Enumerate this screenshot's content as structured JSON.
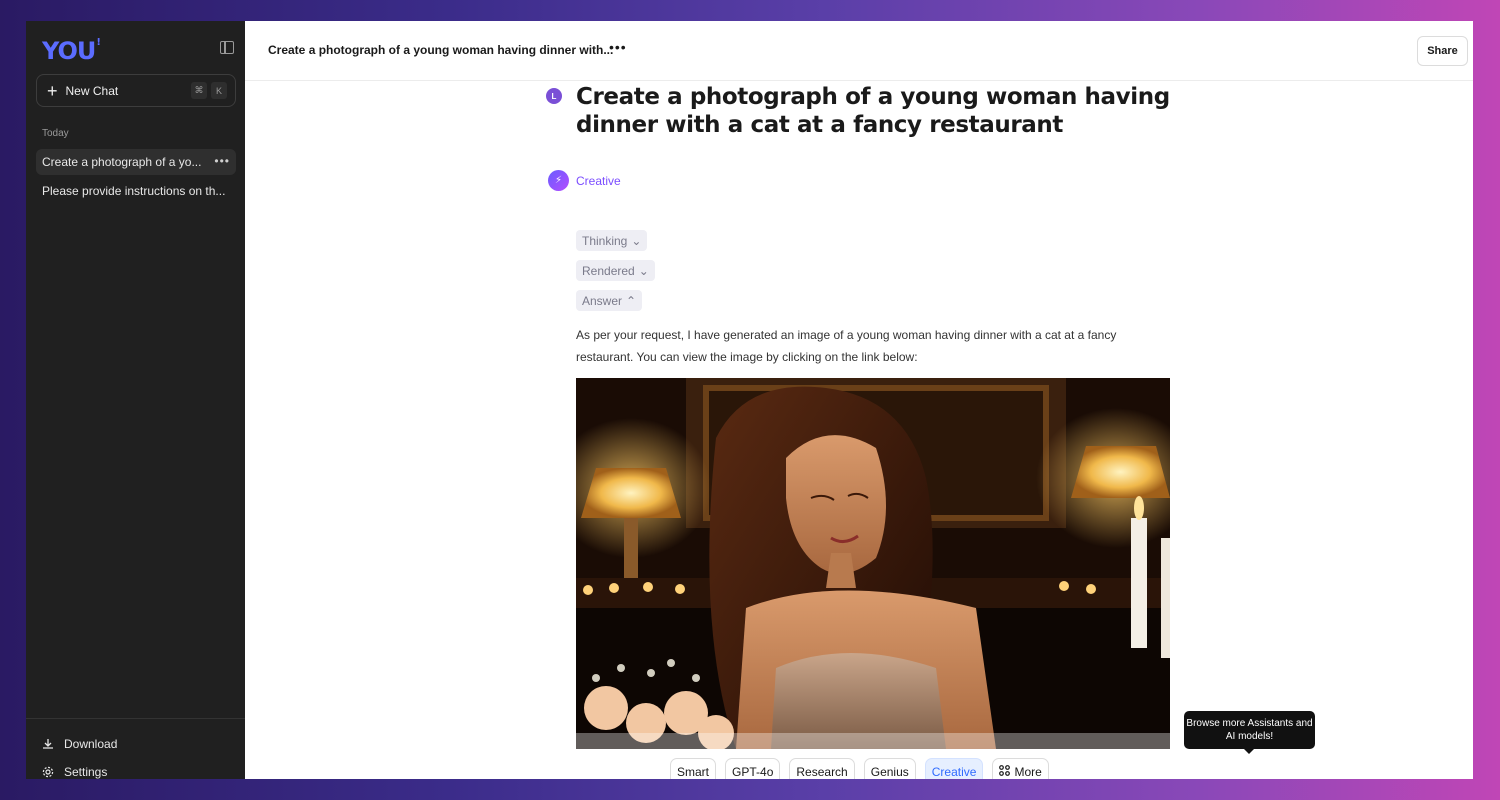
{
  "sidebar": {
    "logo": "YOU",
    "new_chat_label": "New Chat",
    "shortcut_keys": [
      "⌘",
      "K"
    ],
    "section_label": "Today",
    "history": [
      {
        "label": "Create a photograph of a yo...",
        "active": true
      },
      {
        "label": "Please provide instructions on th...",
        "active": false
      }
    ],
    "footer": {
      "download_label": "Download",
      "settings_label": "Settings"
    }
  },
  "header": {
    "title": "Create a photograph of a young woman having dinner with...",
    "more_icon": "ellipsis-icon",
    "share_label": "Share"
  },
  "conversation": {
    "user_initial": "L",
    "question": "Create a photograph of a young woman having dinner with a cat at a fancy restaurant",
    "mode_label": "Creative",
    "steps": [
      {
        "label": "Thinking",
        "chevron": "⌄"
      },
      {
        "label": "Rendered",
        "chevron": "⌄"
      },
      {
        "label": "Answer",
        "chevron": "⌃"
      }
    ],
    "answer_text": "As per your request, I have generated an image of a young woman having dinner with a cat at a fancy restaurant. You can view the image by clicking on the link below:"
  },
  "tooltip": {
    "text": "Browse more Assistants and AI models!"
  },
  "models": [
    {
      "label": "Smart",
      "active": false
    },
    {
      "label": "GPT-4o",
      "active": false
    },
    {
      "label": "Research",
      "active": false
    },
    {
      "label": "Genius",
      "active": false
    },
    {
      "label": "Creative",
      "active": true
    },
    {
      "label": "More",
      "active": false
    }
  ],
  "colors": {
    "accent": "#7b4dff",
    "sidebar_bg": "#202020",
    "active_model": "#2f6bff"
  }
}
